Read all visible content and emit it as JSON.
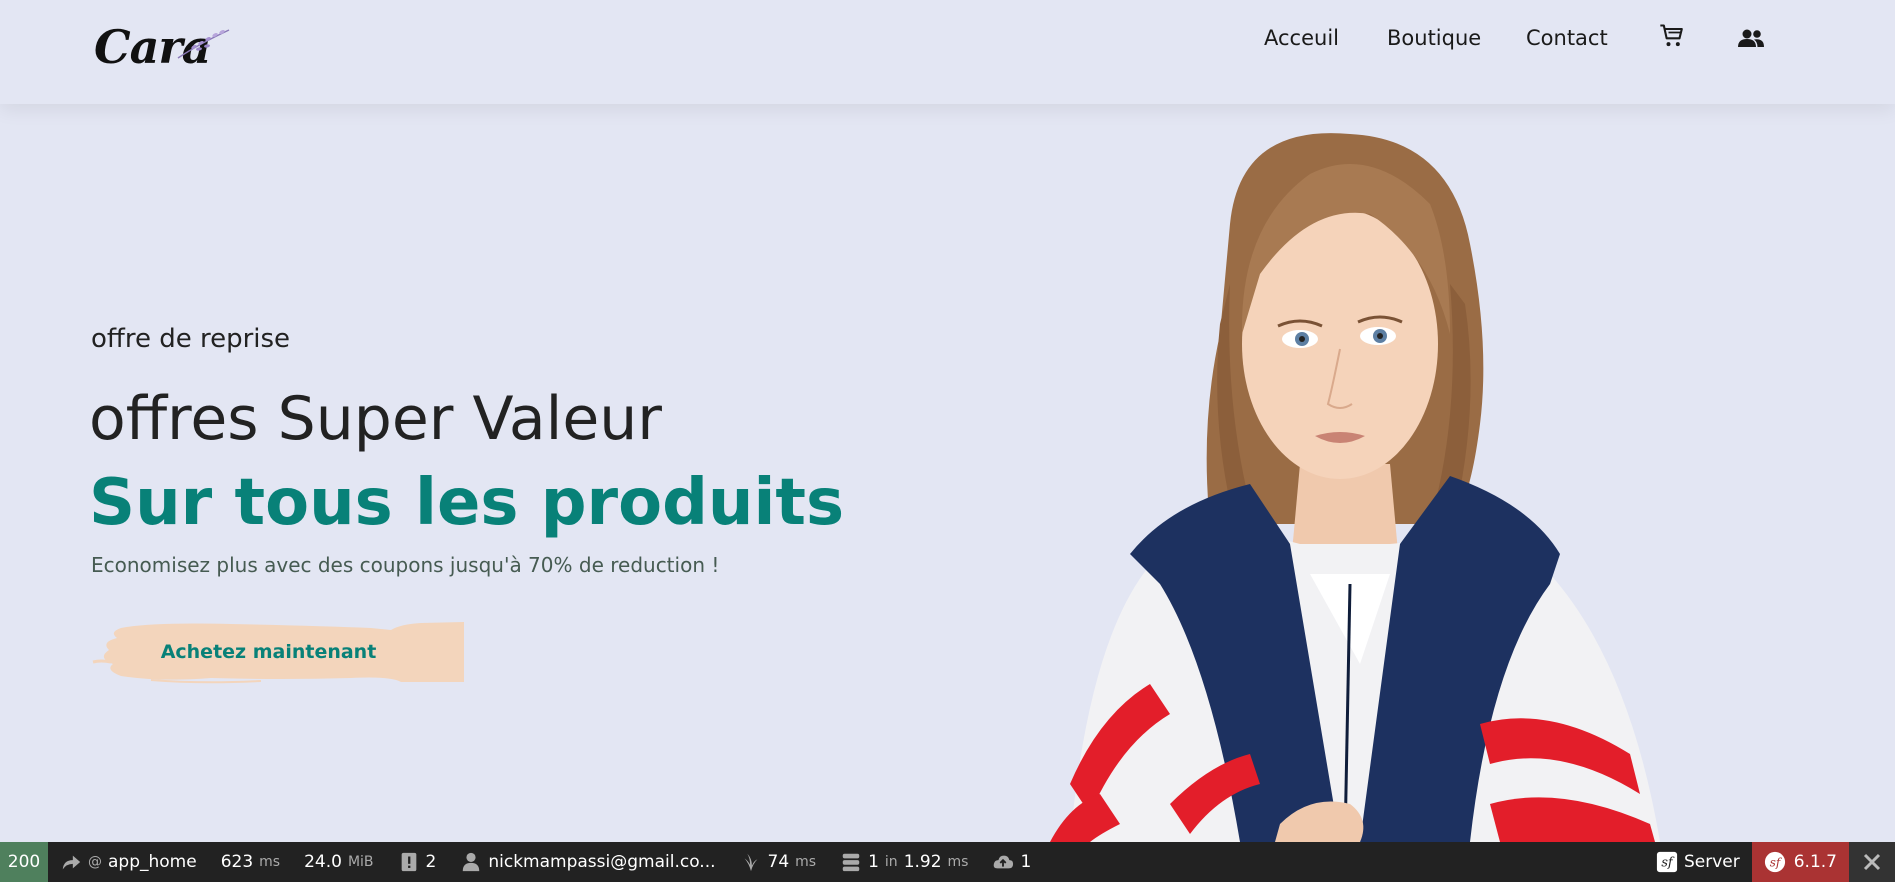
{
  "logo": {
    "text": "Cara"
  },
  "nav": {
    "items": [
      {
        "label": "Acceuil"
      },
      {
        "label": "Boutique"
      },
      {
        "label": "Contact"
      }
    ],
    "cart_icon": "cart-icon",
    "user_icon": "users-icon"
  },
  "hero": {
    "kicker": "offre de reprise",
    "title": "offres Super Valeur",
    "subtitle": "Sur tous les produits",
    "text": "Economisez plus avec des coupons jusqu'à 70% de reduction !",
    "cta_label": "Achetez maintenant",
    "cta_color": "#f3d5bc",
    "accent_color": "#088178"
  },
  "toolbar": {
    "status_code": "200",
    "route_prefix": "@",
    "route": "app_home",
    "time_value": "623",
    "time_unit": "ms",
    "memory_value": "24.0",
    "memory_unit": "MiB",
    "logs_count": "2",
    "user": "nickmampassi@gmail.co...",
    "twig_value": "74",
    "twig_unit": "ms",
    "db_queries": "1",
    "db_in": "in",
    "db_time": "1.92",
    "db_unit": "ms",
    "cache_count": "1",
    "server_label": "Server",
    "version": "6.1.7",
    "status_color": "#4f805d",
    "version_color": "#aa3333"
  }
}
